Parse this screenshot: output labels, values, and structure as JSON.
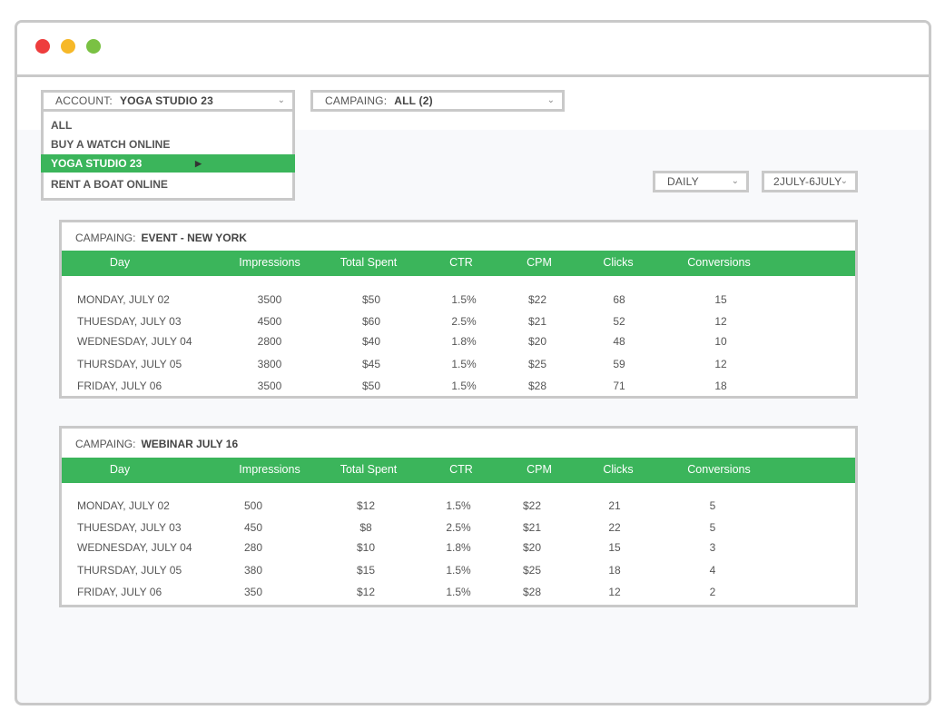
{
  "window": {
    "controls": [
      "close",
      "minimize",
      "maximize"
    ],
    "colors": {
      "close": "#ee3d3d",
      "minimize": "#f6b828",
      "maximize": "#7ac143"
    }
  },
  "filters": {
    "account": {
      "label": "ACCOUNT:",
      "value": "YOGA STUDIO 23"
    },
    "campaign": {
      "label": "CAMPAING:",
      "value": "ALL (2)"
    },
    "period": {
      "value": "DAILY"
    },
    "date_range": {
      "value": "2JULY-6JULY"
    }
  },
  "account_dropdown": {
    "items": [
      "ALL",
      "BUY A WATCH ONLINE",
      "YOGA STUDIO 23",
      "RENT A BOAT ONLINE"
    ],
    "selected": "YOGA STUDIO 23"
  },
  "columns": [
    "Day",
    "Impressions",
    "Total Spent",
    "CTR",
    "CPM",
    "Clicks",
    "Conversions"
  ],
  "tables": [
    {
      "campaign_label": "CAMPAING:",
      "campaign_name": "EVENT - NEW YORK",
      "rows": [
        [
          "MONDAY, JULY 02",
          "3500",
          "$50",
          "1.5%",
          "$22",
          "68",
          "15"
        ],
        [
          "THUESDAY, JULY 03",
          "4500",
          "$60",
          "2.5%",
          "$21",
          "52",
          "12"
        ],
        [
          "WEDNESDAY, JULY 04",
          "2800",
          "$40",
          "1.8%",
          "$20",
          "48",
          "10"
        ],
        [
          "THURSDAY, JULY 05",
          "3800",
          "$45",
          "1.5%",
          "$25",
          "59",
          "12"
        ],
        [
          "FRIDAY, JULY 06",
          "3500",
          "$50",
          "1.5%",
          "$28",
          "71",
          "18"
        ]
      ]
    },
    {
      "campaign_label": "CAMPAING:",
      "campaign_name": "WEBINAR JULY 16",
      "rows": [
        [
          "MONDAY, JULY 02",
          "500",
          "$12",
          "1.5%",
          "$22",
          "21",
          "5"
        ],
        [
          "THUESDAY, JULY 03",
          "450",
          "$8",
          "2.5%",
          "$21",
          "22",
          "5"
        ],
        [
          "WEDNESDAY, JULY 04",
          "280",
          "$10",
          "1.8%",
          "$20",
          "15",
          "3"
        ],
        [
          "THURSDAY, JULY 05",
          "380",
          "$15",
          "1.5%",
          "$25",
          "18",
          "4"
        ],
        [
          "FRIDAY, JULY 06",
          "350",
          "$12",
          "1.5%",
          "$28",
          "12",
          "2"
        ]
      ]
    }
  ],
  "colors": {
    "accent": "#3bb55b",
    "border": "#c9c9c9"
  }
}
